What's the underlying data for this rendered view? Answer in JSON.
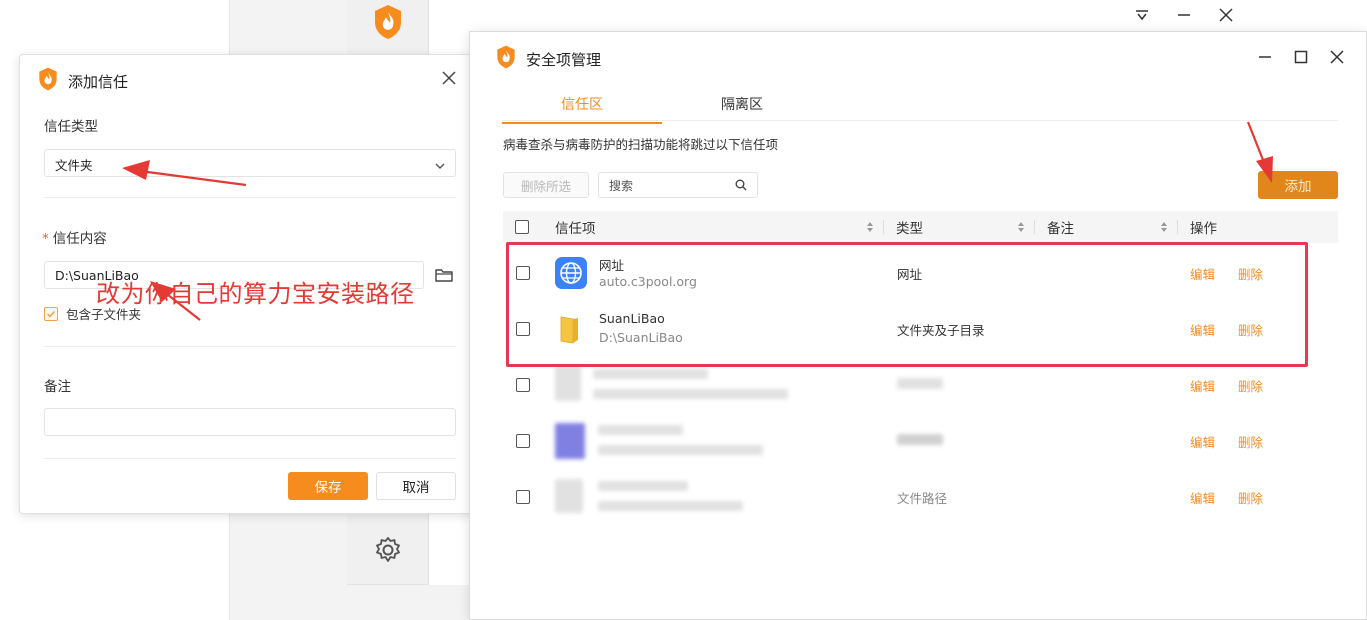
{
  "colors": {
    "accent": "#f68b1e",
    "annotation_red": "#e53935",
    "highlight_border": "#e53950"
  },
  "add_dialog": {
    "title": "添加信任",
    "trust_type_label": "信任类型",
    "trust_type_value": "文件夹",
    "trust_content_label": "信任内容",
    "required_mark": "*",
    "path_value": "D:\\SuanLiBao",
    "include_subfolders_label": "包含子文件夹",
    "include_subfolders_checked": true,
    "note_label": "备注",
    "note_value": "",
    "save_label": "保存",
    "cancel_label": "取消"
  },
  "annotation_text": "改为你自己的算力宝安装路径",
  "security_window": {
    "title": "安全项管理",
    "tabs": [
      {
        "label": "信任区",
        "active": true
      },
      {
        "label": "隔离区",
        "active": false
      }
    ],
    "description": "病毒查杀与病毒防护的扫描功能将跳过以下信任项",
    "delete_selected_label": "删除所选",
    "search_placeholder": "搜索",
    "add_label": "添加",
    "columns": [
      "信任项",
      "类型",
      "备注",
      "操作"
    ],
    "rows": [
      {
        "name": "网址",
        "sub": "auto.c3pool.org",
        "type": "网址",
        "icon": "globe-icon",
        "edit": "编辑",
        "delete": "删除"
      },
      {
        "name": "SuanLiBao",
        "sub": "D:\\SuanLiBao",
        "type": "文件夹及子目录",
        "icon": "folder-icon",
        "edit": "编辑",
        "delete": "删除"
      },
      {
        "name": "",
        "sub": "",
        "type": "",
        "icon": "blurred-icon",
        "edit": "编辑",
        "delete": "删除"
      },
      {
        "name": "",
        "sub": "",
        "type": "",
        "icon": "blurred-icon",
        "edit": "编辑",
        "delete": "删除"
      },
      {
        "name": "",
        "sub": "",
        "type": "文件路径",
        "icon": "blurred-icon",
        "edit": "编辑",
        "delete": "删除"
      }
    ]
  }
}
